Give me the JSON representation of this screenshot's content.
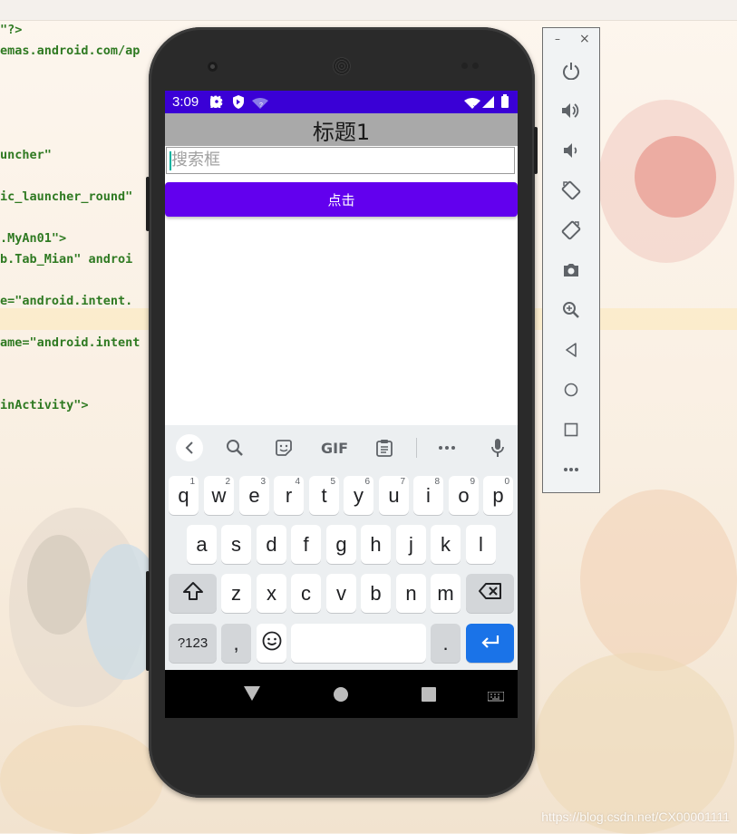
{
  "code": {
    "lines": [
      {
        "text": "\"?>"
      },
      {
        "text": "emas.android.com/ap"
      },
      {
        "text": "uncher\""
      },
      {
        "text": "ic_launcher_round\""
      },
      {
        "text": ".MyAn01\">"
      },
      {
        "text": "b.Tab_Mian\" androi"
      },
      {
        "text": "e=\"android.intent."
      },
      {
        "text": "ame=\"android.intent"
      },
      {
        "text": "inActivity\">"
      }
    ]
  },
  "statusbar": {
    "time": "3:09",
    "icons": [
      "settings-icon",
      "shield-icon",
      "wifi-question-icon",
      "wifi-icon",
      "signal-icon",
      "battery-icon"
    ]
  },
  "app": {
    "title": "标题1",
    "search_placeholder": "搜索框",
    "button_label": "点击",
    "accent_color": "#6200ee",
    "statusbar_color": "#3a00d6"
  },
  "keyboard": {
    "toolbar": [
      "back-chevron-icon",
      "search-icon",
      "sticker-icon",
      "GIF",
      "clipboard-icon",
      "more-icon",
      "mic-icon"
    ],
    "row1": [
      {
        "k": "q",
        "h": "1"
      },
      {
        "k": "w",
        "h": "2"
      },
      {
        "k": "e",
        "h": "3"
      },
      {
        "k": "r",
        "h": "4"
      },
      {
        "k": "t",
        "h": "5"
      },
      {
        "k": "y",
        "h": "6"
      },
      {
        "k": "u",
        "h": "7"
      },
      {
        "k": "i",
        "h": "8"
      },
      {
        "k": "o",
        "h": "9"
      },
      {
        "k": "p",
        "h": "0"
      }
    ],
    "row2": [
      "a",
      "s",
      "d",
      "f",
      "g",
      "h",
      "j",
      "k",
      "l"
    ],
    "row3": [
      "z",
      "x",
      "c",
      "v",
      "b",
      "n",
      "m"
    ],
    "symbols_label": "?123",
    "comma": ",",
    "period": ".",
    "enter_color": "#1a73e8"
  },
  "emulator_panel": {
    "window_buttons": [
      "–",
      "×"
    ],
    "icons": [
      "power-icon",
      "volume-up-icon",
      "volume-down-icon",
      "rotate-left-icon",
      "rotate-right-icon",
      "camera-icon",
      "zoom-icon",
      "back-icon",
      "home-icon",
      "overview-icon",
      "more-icon"
    ]
  },
  "watermark": "https://blog.csdn.net/CX00001111"
}
